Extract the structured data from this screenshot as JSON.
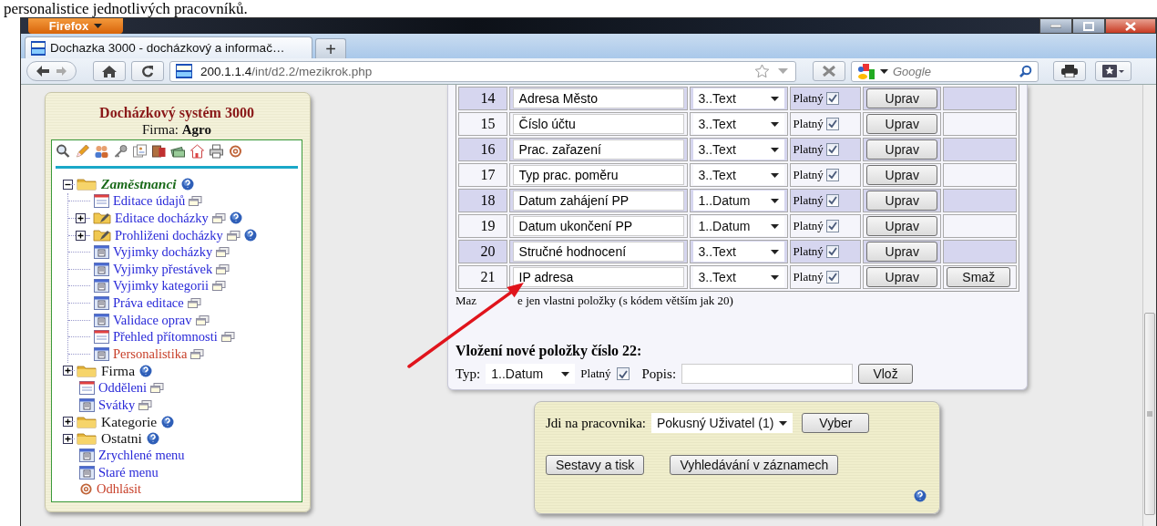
{
  "document_text": "personalistice jednotlivých pracovníků.",
  "browser": {
    "app_menu": "Firefox",
    "tab": {
      "title": "Dochazka 3000 - docházkový a informač…",
      "selected": true
    },
    "new_tab": "+",
    "address": {
      "host": "200.1.1.4",
      "path": "/int/d2.2/mezikrok.php"
    },
    "search": {
      "placeholder": "Google"
    }
  },
  "sidebar": {
    "title": "Docházkový systém 3000",
    "company_label": "Firma:",
    "company": "Agro",
    "tree": [
      {
        "label": "Zaměstnanci",
        "kind": "folder",
        "expanded": true,
        "help": true,
        "children": [
          {
            "label": "Editace údajů",
            "kind": "calendar",
            "popup": true,
            "selected": false
          },
          {
            "label": "Editace docházky",
            "kind": "subfolder",
            "expanded": false,
            "popup": true,
            "help": true,
            "selected": false
          },
          {
            "label": "Prohliženi docházky",
            "kind": "subfolder",
            "expanded": false,
            "popup": true,
            "help": true,
            "selected": false
          },
          {
            "label": "Vyjimky docházky",
            "kind": "page",
            "popup": true,
            "selected": false
          },
          {
            "label": "Vyjimky přestávek",
            "kind": "page",
            "popup": true,
            "selected": false
          },
          {
            "label": "Vyjimky kategorii",
            "kind": "page",
            "popup": true,
            "selected": false
          },
          {
            "label": "Práva editace",
            "kind": "page",
            "popup": true,
            "selected": false
          },
          {
            "label": "Validace oprav",
            "kind": "page",
            "popup": true,
            "selected": false
          },
          {
            "label": "Přehled přítomnosti",
            "kind": "calendar",
            "popup": true,
            "selected": false
          },
          {
            "label": "Personalistika",
            "kind": "page",
            "popup": true,
            "selected": true
          }
        ]
      },
      {
        "label": "Firma",
        "kind": "folder",
        "expanded": false,
        "help": true
      },
      {
        "label": "Odděleni",
        "kind": "calendar",
        "popup": true,
        "selected": false
      },
      {
        "label": "Svátky",
        "kind": "page",
        "popup": true,
        "selected": false
      },
      {
        "label": "Kategorie",
        "kind": "folder",
        "expanded": false,
        "help": true
      },
      {
        "label": "Ostatni",
        "kind": "folder",
        "expanded": false,
        "help": true
      },
      {
        "label": "Zrychlené menu",
        "kind": "page",
        "selected": false
      },
      {
        "label": "Staré menu",
        "kind": "page",
        "selected": false
      },
      {
        "label": "Odhlásit",
        "kind": "logout"
      }
    ]
  },
  "fields_table": {
    "rows": [
      {
        "code": "14",
        "name": "Adresa Město",
        "type": "3..Text",
        "valid_label": "Platný",
        "valid": true,
        "edit_button": "Uprav"
      },
      {
        "code": "15",
        "name": "Číslo účtu",
        "type": "3..Text",
        "valid_label": "Platný",
        "valid": true,
        "edit_button": "Uprav"
      },
      {
        "code": "16",
        "name": "Prac. zařazení",
        "type": "3..Text",
        "valid_label": "Platný",
        "valid": true,
        "edit_button": "Uprav"
      },
      {
        "code": "17",
        "name": "Typ prac. poměru",
        "type": "3..Text",
        "valid_label": "Platný",
        "valid": true,
        "edit_button": "Uprav"
      },
      {
        "code": "18",
        "name": "Datum zahájení PP",
        "type": "1..Datum",
        "valid_label": "Platný",
        "valid": true,
        "edit_button": "Uprav"
      },
      {
        "code": "19",
        "name": "Datum ukončení PP",
        "type": "1..Datum",
        "valid_label": "Platný",
        "valid": true,
        "edit_button": "Uprav"
      },
      {
        "code": "20",
        "name": "Stručné hodnocení",
        "type": "3..Text",
        "valid_label": "Platný",
        "valid": true,
        "edit_button": "Uprav"
      },
      {
        "code": "21",
        "name": "IP adresa",
        "type": "3..Text",
        "valid_label": "Platný",
        "valid": true,
        "edit_button": "Uprav",
        "delete_button": "Smaž"
      }
    ],
    "note_parts": [
      "Maz",
      "e jen vlastni položky (s kódem větším jak 20)"
    ]
  },
  "new_item": {
    "heading": "Vložení nové položky číslo 22:",
    "type_label": "Typ:",
    "type": "1..Datum",
    "valid_label": "Platný",
    "valid": true,
    "description_label": "Popis:",
    "submit_button": "Vlož"
  },
  "employee_panel": {
    "label": "Jdi na pracovnika:",
    "employee": "Pokusný Uživatel (1)",
    "select_button": "Vyber",
    "buttons": [
      "Sestavy a tisk",
      "Vyhledávání v záznamech"
    ]
  }
}
